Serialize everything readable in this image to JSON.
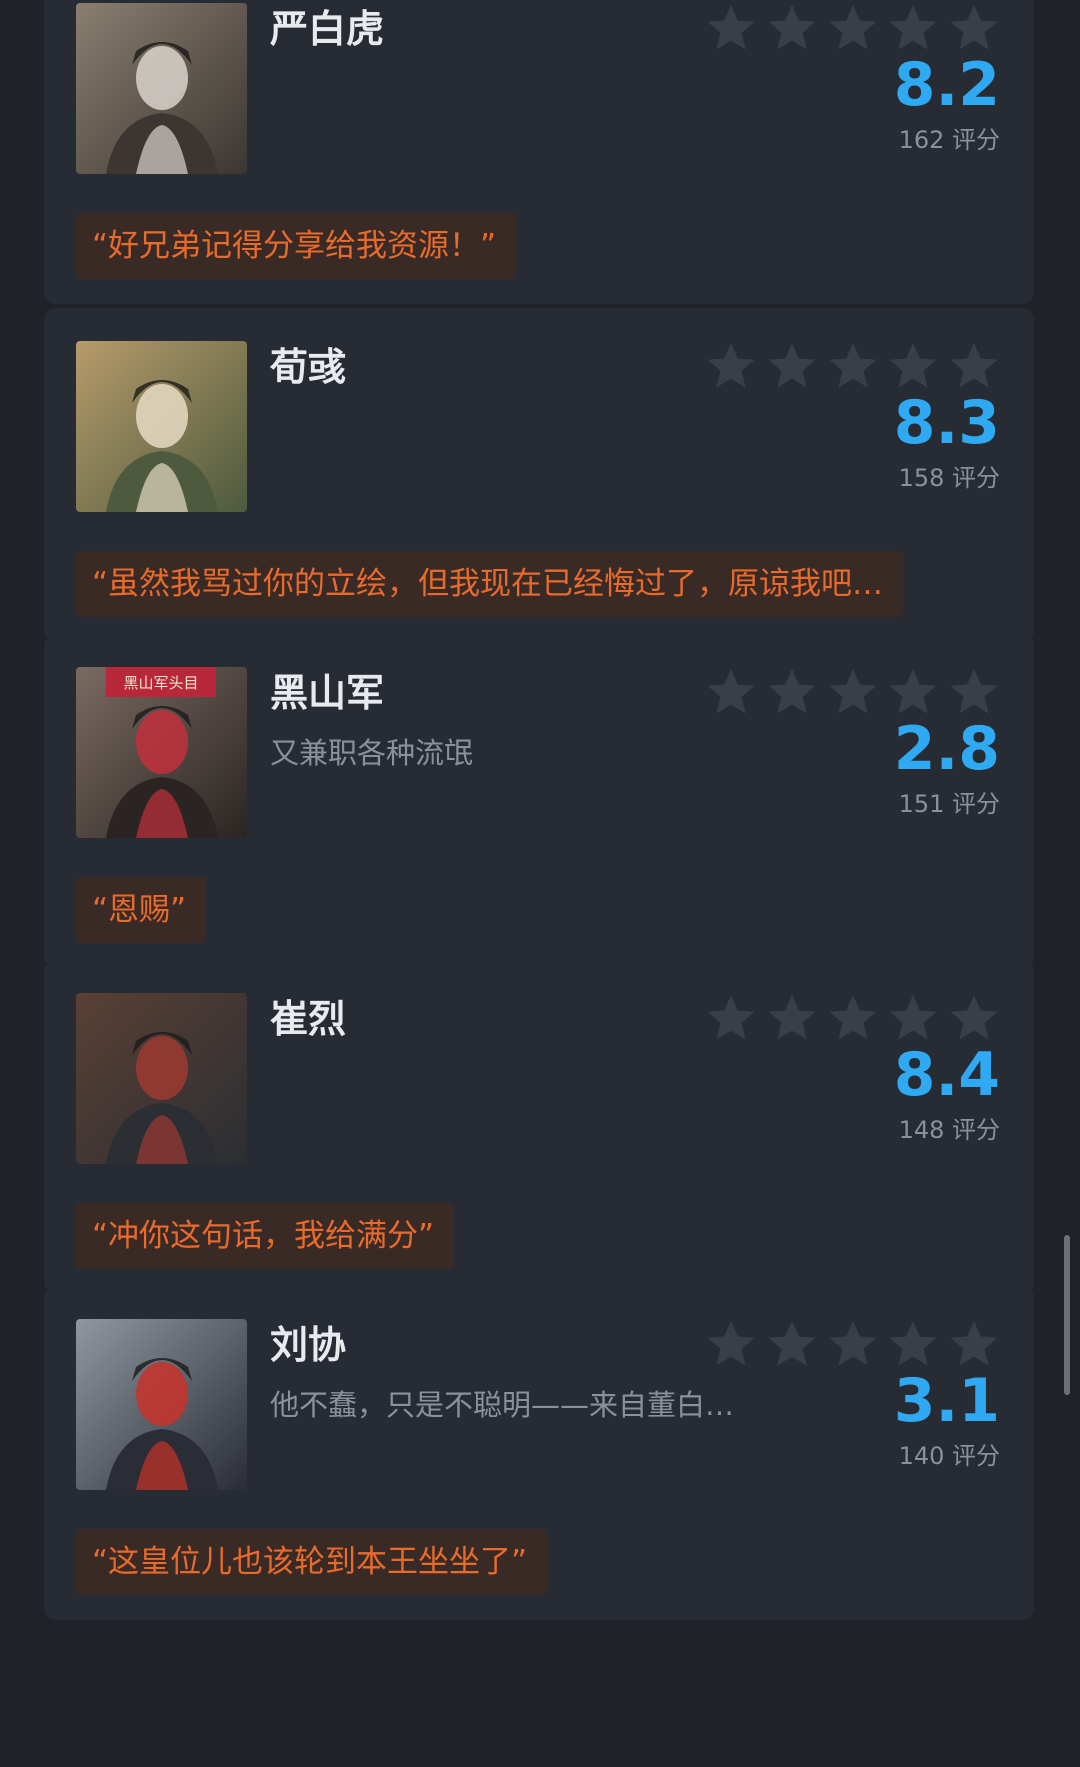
{
  "reviews": [
    {
      "name": "严白虎",
      "subtitle": "",
      "score": "8.2",
      "rating_count": "162 评分",
      "quote": "“好兄弟记得分享给我资源！”",
      "avatar_icon": "character-portrait-white-hair-swordsman",
      "stars_filled": 0,
      "colors": {
        "a": "#8a7f70",
        "b": "#d8d4cc",
        "c": "#3b3632"
      }
    },
    {
      "name": "荀彧",
      "subtitle": "",
      "score": "8.3",
      "rating_count": "158 评分",
      "quote": "“虽然我骂过你的立绘，但我现在已经悔过了，原谅我吧…",
      "avatar_icon": "character-portrait-scholar-with-orchids",
      "stars_filled": 0,
      "colors": {
        "a": "#b79b6a",
        "b": "#e5dcc4",
        "c": "#4d5a3e"
      }
    },
    {
      "name": "黑山军",
      "subtitle": "又兼职各种流氓",
      "score": "2.8",
      "rating_count": "151 评分",
      "quote": "“恩赐”",
      "avatar_icon": "character-portrait-red-robe-bandit",
      "stars_filled": 0,
      "banner_text": "黑山军头目",
      "colors": {
        "a": "#7a6a62",
        "b": "#c2303b",
        "c": "#2a2522"
      }
    },
    {
      "name": "崔烈",
      "subtitle": "",
      "score": "8.4",
      "rating_count": "148 评分",
      "quote": "“冲你这句话，我给满分”",
      "avatar_icon": "character-portrait-official-red-cloak",
      "stars_filled": 0,
      "colors": {
        "a": "#5a4034",
        "b": "#9e3a30",
        "c": "#2b2e33"
      }
    },
    {
      "name": "刘协",
      "subtitle": "他不蠢，只是不聪明——来自董白…",
      "score": "3.1",
      "rating_count": "140 评分",
      "quote": "“这皇位儿也该轮到本王坐坐了”",
      "avatar_icon": "character-portrait-young-emperor",
      "stars_filled": 0,
      "colors": {
        "a": "#8f97a0",
        "b": "#c8322a",
        "c": "#2a2d35"
      }
    }
  ],
  "theme": {
    "background": "#1f2229",
    "card": "#272b34",
    "score_color": "#2fa9f2",
    "quote_color": "#e86b2c",
    "quote_bg": "#3a2a26",
    "star_empty": "#3a3e47"
  }
}
